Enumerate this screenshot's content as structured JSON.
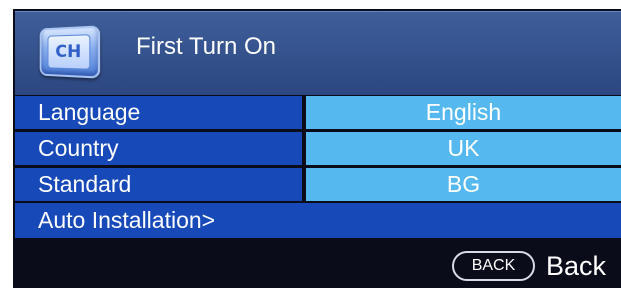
{
  "header": {
    "icon": "ch-icon",
    "icon_text": "CH",
    "title": "First Turn On"
  },
  "menu": {
    "rows": [
      {
        "label": "Language",
        "value": "English"
      },
      {
        "label": "Country",
        "value": "UK"
      },
      {
        "label": "Standard",
        "value": "BG"
      }
    ],
    "auto_installation": "Auto Installation>"
  },
  "footer": {
    "back_key": "BACK",
    "back_label": "Back"
  },
  "colors": {
    "label_bg": "#1749b8",
    "value_bg": "#55b8ef",
    "header_bg": "#34518c",
    "frame_bg": "#0b0c1a"
  }
}
